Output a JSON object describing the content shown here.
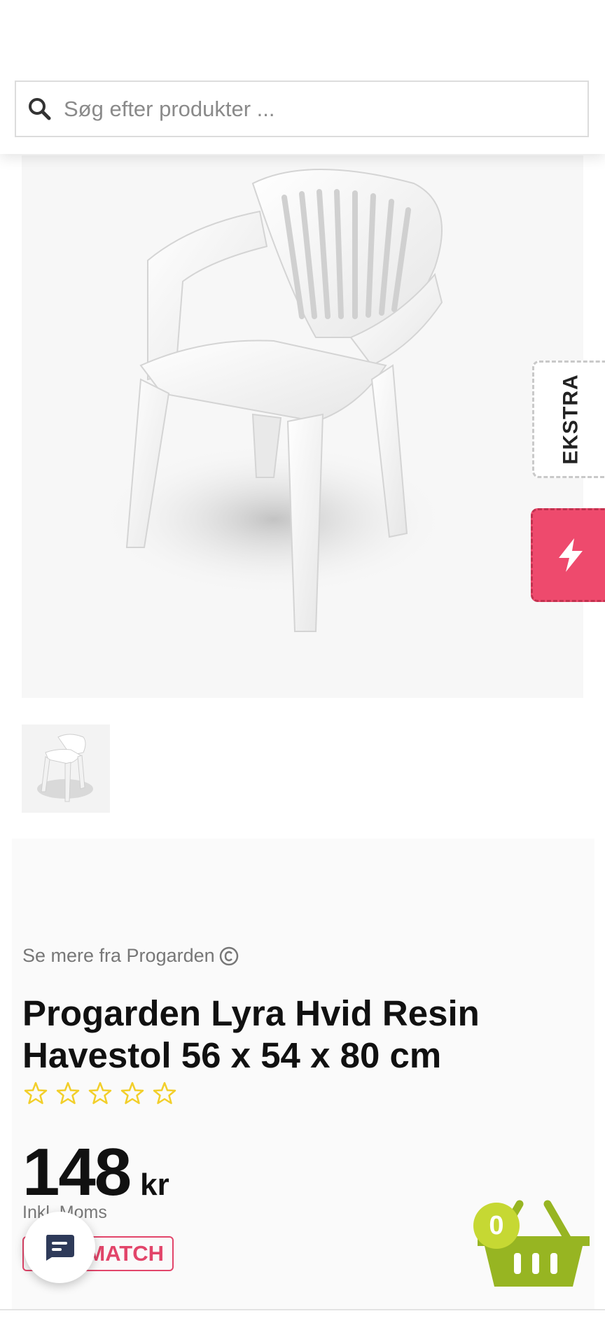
{
  "search": {
    "placeholder": "Søg efter produkter ...",
    "icon": "search-icon"
  },
  "side_tabs": {
    "ekstra_label": "EKSTRA",
    "flash_icon": "lightning-icon",
    "flash_color": "#ee4a6d"
  },
  "product": {
    "brand_link": "Se mere fra Progarden",
    "brand_icon": "copyright-icon",
    "title": "Progarden Lyra Hvid Resin Havestol 56 x 54 x 80 cm",
    "rating": {
      "value": 0,
      "max": 5,
      "star_color": "#f2cf2a"
    },
    "price": "148",
    "currency": "kr",
    "vat_note": "Inkl. Moms",
    "price_match_label": "MATCH",
    "price_match_color": "#e2456a"
  },
  "chat": {
    "icon": "chat-icon"
  },
  "cart": {
    "count": "0",
    "icon": "basket-icon",
    "color": "#97b522"
  }
}
